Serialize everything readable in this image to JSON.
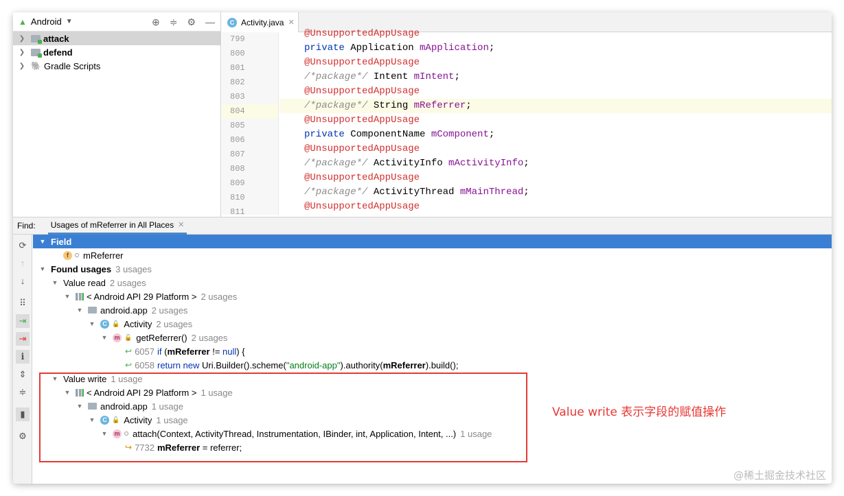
{
  "project": {
    "title": "Android",
    "items": [
      {
        "label": "attack",
        "bold": true
      },
      {
        "label": "defend",
        "bold": true
      },
      {
        "label": "Gradle Scripts",
        "bold": false
      }
    ]
  },
  "editor": {
    "tab_label": "Activity.java",
    "tab_icon_letter": "C",
    "line_numbers": [
      "799",
      "800",
      "801",
      "802",
      "803",
      "804",
      "805",
      "806",
      "807",
      "808",
      "809",
      "810",
      "811"
    ]
  },
  "code": {
    "annotation": "@UnsupportedAppUsage",
    "private_kw": "private",
    "pkg_comment": "/*package*/",
    "l800_type": " Application ",
    "l800_field": "mApplication",
    "l802_type": " Intent ",
    "l802_field": "mIntent",
    "l804_type": " String ",
    "l804_field": "mReferrer",
    "l806_type": " ComponentName ",
    "l806_field": "mComponent",
    "l808_type": " ActivityInfo ",
    "l808_field": "mActivityInfo",
    "l810_type": " ActivityThread ",
    "l810_field": "mMainThread",
    "semi": ";"
  },
  "find": {
    "label": "Find:",
    "tab_label": "Usages of mReferrer in All Places"
  },
  "results": {
    "field_header": "Field",
    "field_name": "mReferrer",
    "found_usages": "Found usages",
    "found_count": "3 usages",
    "value_read": "Value read",
    "value_read_count": "2 usages",
    "platform": "< Android API 29 Platform >",
    "platform_count_read": "2 usages",
    "package": "android.app",
    "package_count_read": "2 usages",
    "class_name": "Activity",
    "class_count_read": "2 usages",
    "method_read": "getReferrer()",
    "method_read_count": "2 usages",
    "usage1_line": "6057",
    "usage1_if": "if",
    "usage1_open": " (",
    "usage1_field": "mReferrer",
    "usage1_op": " != ",
    "usage1_null": "null",
    "usage1_close": ") {",
    "usage2_line": "6058",
    "usage2_return": "return new",
    "usage2_a": " Uri.Builder().scheme(",
    "usage2_str": "\"android-app\"",
    "usage2_b": ").authority(",
    "usage2_field": "mReferrer",
    "usage2_c": ").build();",
    "value_write": "Value write",
    "value_write_count": "1 usage",
    "platform_count_write": "1 usage",
    "package_count_write": "1 usage",
    "class_count_write": "1 usage",
    "method_write": "attach(Context, ActivityThread, Instrumentation, IBinder, int, Application, Intent, ...)",
    "method_write_count": "1 usage",
    "usage3_line": "7732",
    "usage3_field": "mReferrer",
    "usage3_rest": " = referrer;"
  },
  "annotation_text": "Value write 表示字段的赋值操作",
  "watermark": "@稀土掘金技术社区",
  "colors": {
    "annotation_red": "#e53935",
    "selection_blue": "#3b7fd4"
  }
}
